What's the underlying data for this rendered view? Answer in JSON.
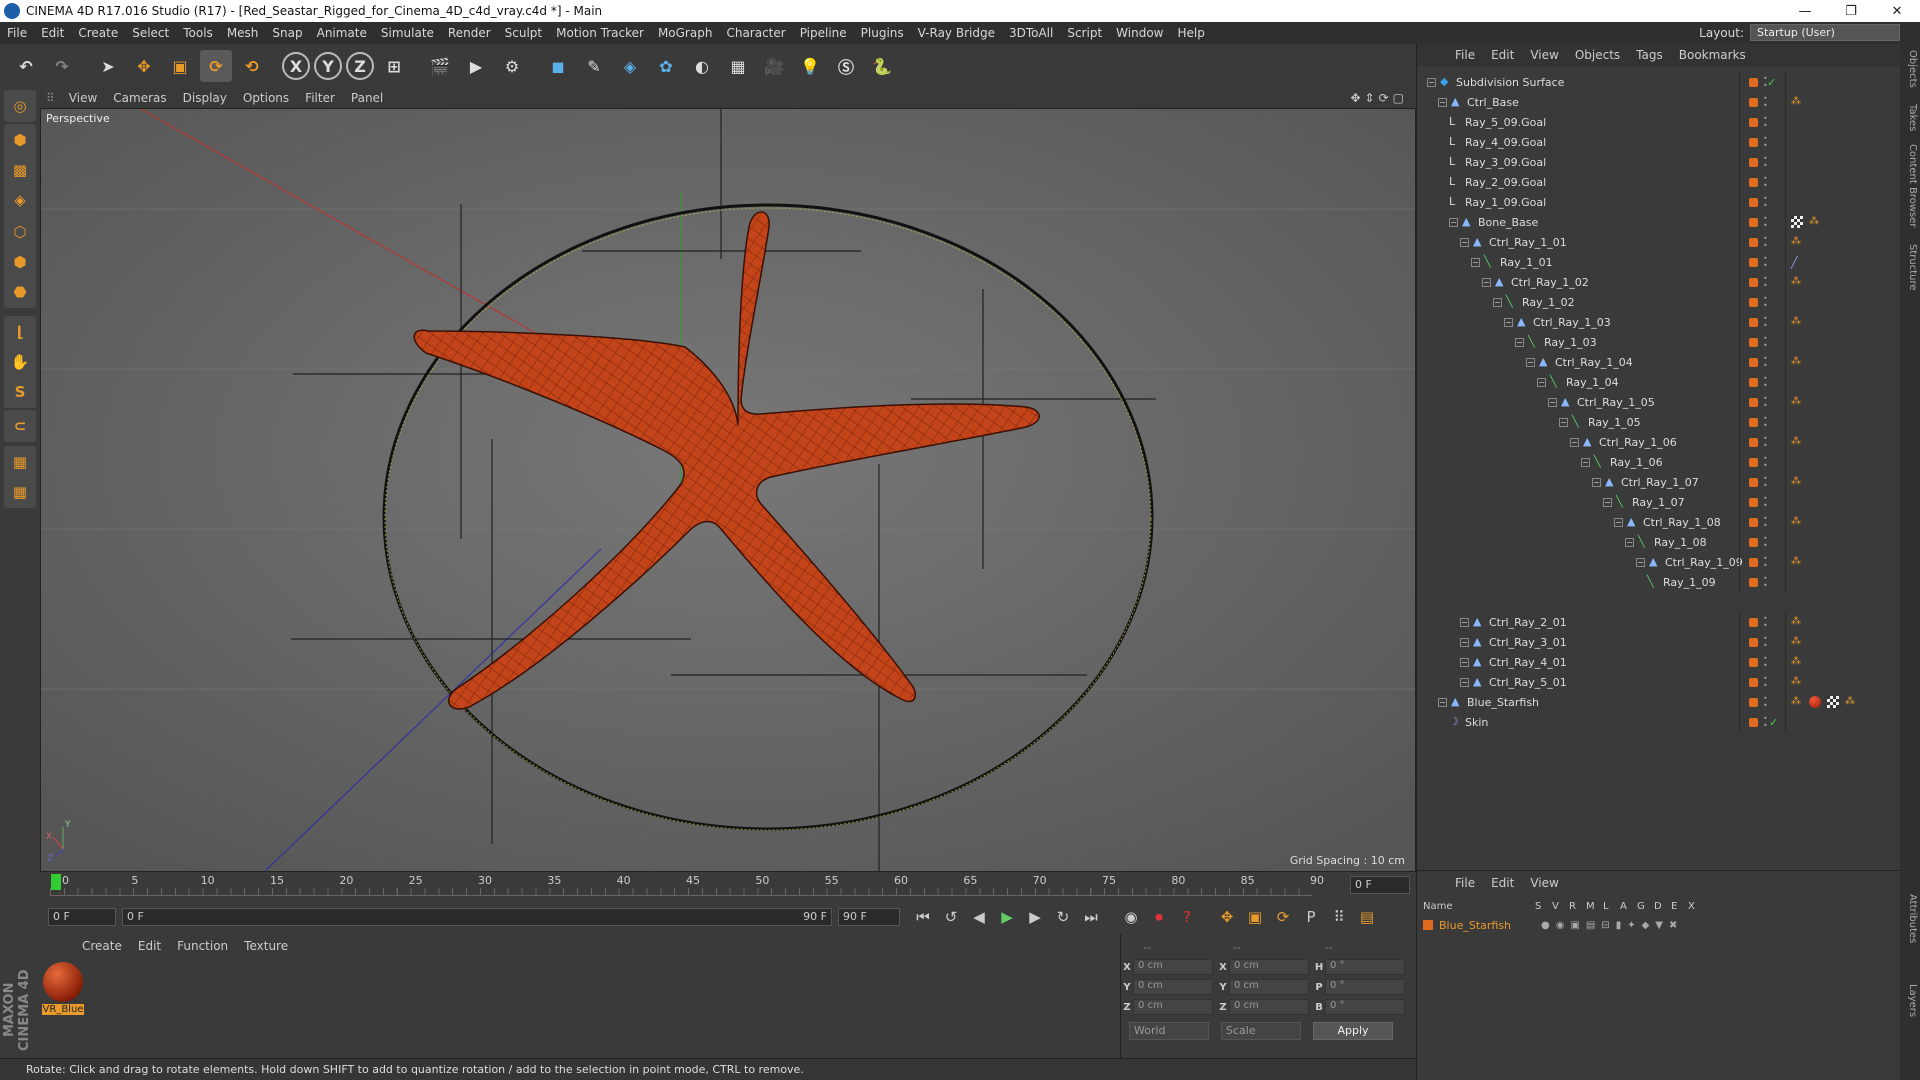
{
  "window": {
    "title": "CINEMA 4D R17.016 Studio (R17) - [Red_Seastar_Rigged_for_Cinema_4D_c4d_vray.c4d *] - Main",
    "controls": [
      "—",
      "❐",
      "✕"
    ]
  },
  "menubar": {
    "items": [
      "File",
      "Edit",
      "Create",
      "Select",
      "Tools",
      "Mesh",
      "Snap",
      "Animate",
      "Simulate",
      "Render",
      "Sculpt",
      "Motion Tracker",
      "MoGraph",
      "Character",
      "Pipeline",
      "Plugins",
      "V-Ray Bridge",
      "3DToAll",
      "Script",
      "Window",
      "Help"
    ],
    "layout_label": "Layout:",
    "layout_value": "Startup (User)"
  },
  "toolbar": {
    "buttons": [
      {
        "name": "undo",
        "glyph": "↶"
      },
      {
        "name": "redo",
        "glyph": "↷"
      },
      {
        "name": "select-arrow",
        "glyph": "➤"
      },
      {
        "name": "move",
        "glyph": "✥"
      },
      {
        "name": "scale",
        "glyph": "▣"
      },
      {
        "name": "rotate",
        "glyph": "⟳"
      },
      {
        "name": "recent",
        "glyph": "⟲"
      },
      {
        "name": "axis-x",
        "glyph": "X"
      },
      {
        "name": "axis-y",
        "glyph": "Y"
      },
      {
        "name": "axis-z",
        "glyph": "Z"
      },
      {
        "name": "world-coords",
        "glyph": "⊞"
      },
      {
        "name": "render-view",
        "glyph": "🎬"
      },
      {
        "name": "render-picture",
        "glyph": "▶"
      },
      {
        "name": "render-settings",
        "glyph": "⚙"
      },
      {
        "name": "cube",
        "glyph": "◼"
      },
      {
        "name": "pen",
        "glyph": "✎"
      },
      {
        "name": "subdivision",
        "glyph": "◈"
      },
      {
        "name": "array",
        "glyph": "✿"
      },
      {
        "name": "deformer",
        "glyph": "◐"
      },
      {
        "name": "floor",
        "glyph": "▦"
      },
      {
        "name": "camera",
        "glyph": "🎥"
      },
      {
        "name": "light",
        "glyph": "💡"
      },
      {
        "name": "vray",
        "glyph": "Ⓢ"
      },
      {
        "name": "python",
        "glyph": "🐍"
      }
    ]
  },
  "viewport": {
    "menu": [
      "View",
      "Cameras",
      "Display",
      "Options",
      "Filter",
      "Panel"
    ],
    "label": "Perspective",
    "grid_spacing": "Grid Spacing : 10 cm"
  },
  "timeline": {
    "ticks": [
      "0",
      "5",
      "10",
      "15",
      "20",
      "25",
      "30",
      "35",
      "40",
      "45",
      "50",
      "55",
      "60",
      "65",
      "70",
      "75",
      "80",
      "85",
      "90"
    ],
    "current_frame": "0 F"
  },
  "transport": {
    "start": "0 F",
    "range_start": "0 F",
    "range_end": "90 F",
    "end": "90 F"
  },
  "material_panel": {
    "menu": [
      "Create",
      "Edit",
      "Function",
      "Texture"
    ],
    "material_name": "VR_Blue"
  },
  "coords": {
    "header": [
      "--",
      "--",
      "--"
    ],
    "rows": [
      {
        "a": "X",
        "av": "0 cm",
        "b": "X",
        "bv": "0 cm",
        "c": "H",
        "cv": "0 °"
      },
      {
        "a": "Y",
        "av": "0 cm",
        "b": "Y",
        "bv": "0 cm",
        "c": "P",
        "cv": "0 °"
      },
      {
        "a": "Z",
        "av": "0 cm",
        "b": "Z",
        "bv": "0 cm",
        "c": "B",
        "cv": "0 °"
      }
    ],
    "world": "World",
    "scale": "Scale",
    "apply": "Apply"
  },
  "status": "Rotate: Click and drag to rotate elements. Hold down SHIFT to add to quantize rotation / add to the selection in point mode, CTRL to remove.",
  "object_manager": {
    "menu": [
      "File",
      "Edit",
      "View",
      "Objects",
      "Tags",
      "Bookmarks"
    ],
    "items": [
      {
        "name": "Subdivision Surface",
        "level": 0,
        "type": "subd"
      },
      {
        "name": "Ctrl_Base",
        "level": 1,
        "type": "null"
      },
      {
        "name": "Ray_5_09.Goal",
        "level": 2,
        "type": "goal"
      },
      {
        "name": "Ray_4_09.Goal",
        "level": 2,
        "type": "goal"
      },
      {
        "name": "Ray_3_09.Goal",
        "level": 2,
        "type": "goal"
      },
      {
        "name": "Ray_2_09.Goal",
        "level": 2,
        "type": "goal"
      },
      {
        "name": "Ray_1_09.Goal",
        "level": 2,
        "type": "goal"
      },
      {
        "name": "Bone_Base",
        "level": 2,
        "type": "null"
      },
      {
        "name": "Ctrl_Ray_1_01",
        "level": 3,
        "type": "null"
      },
      {
        "name": "Ray_1_01",
        "level": 4,
        "type": "bone"
      },
      {
        "name": "Ctrl_Ray_1_02",
        "level": 5,
        "type": "null"
      },
      {
        "name": "Ray_1_02",
        "level": 6,
        "type": "bone"
      },
      {
        "name": "Ctrl_Ray_1_03",
        "level": 7,
        "type": "null"
      },
      {
        "name": "Ray_1_03",
        "level": 8,
        "type": "bone"
      },
      {
        "name": "Ctrl_Ray_1_04",
        "level": 9,
        "type": "null"
      },
      {
        "name": "Ray_1_04",
        "level": 10,
        "type": "bone"
      },
      {
        "name": "Ctrl_Ray_1_05",
        "level": 11,
        "type": "null"
      },
      {
        "name": "Ray_1_05",
        "level": 12,
        "type": "bone"
      },
      {
        "name": "Ctrl_Ray_1_06",
        "level": 13,
        "type": "null"
      },
      {
        "name": "Ray_1_06",
        "level": 14,
        "type": "bone"
      },
      {
        "name": "Ctrl_Ray_1_07",
        "level": 15,
        "type": "null"
      },
      {
        "name": "Ray_1_07",
        "level": 16,
        "type": "bone"
      },
      {
        "name": "Ctrl_Ray_1_08",
        "level": 17,
        "type": "null"
      },
      {
        "name": "Ray_1_08",
        "level": 18,
        "type": "bone"
      },
      {
        "name": "Ctrl_Ray_1_09",
        "level": 19,
        "type": "null"
      },
      {
        "name": "Ray_1_09",
        "level": 20,
        "type": "bone"
      },
      {
        "name": "",
        "level": 0,
        "type": "gap"
      },
      {
        "name": "Ctrl_Ray_2_01",
        "level": 3,
        "type": "null"
      },
      {
        "name": "Ctrl_Ray_3_01",
        "level": 3,
        "type": "null"
      },
      {
        "name": "Ctrl_Ray_4_01",
        "level": 3,
        "type": "null"
      },
      {
        "name": "Ctrl_Ray_5_01",
        "level": 3,
        "type": "null"
      },
      {
        "name": "Blue_Starfish",
        "level": 1,
        "type": "null"
      },
      {
        "name": "Skin",
        "level": 2,
        "type": "skin"
      }
    ]
  },
  "layer_manager": {
    "menu": [
      "File",
      "Edit",
      "View"
    ],
    "columns": [
      "Name",
      "S",
      "V",
      "R",
      "M",
      "L",
      "A",
      "G",
      "D",
      "E",
      "X"
    ],
    "layer_name": "Blue_Starfish"
  },
  "side_tabs": [
    "Objects",
    "Takes",
    "Content Browser",
    "Structure",
    "Attributes",
    "Layers"
  ],
  "colors": {
    "accent": "#e89a2a",
    "starfish": "#c4441a",
    "viewport_bg": "#6b6b6b"
  }
}
